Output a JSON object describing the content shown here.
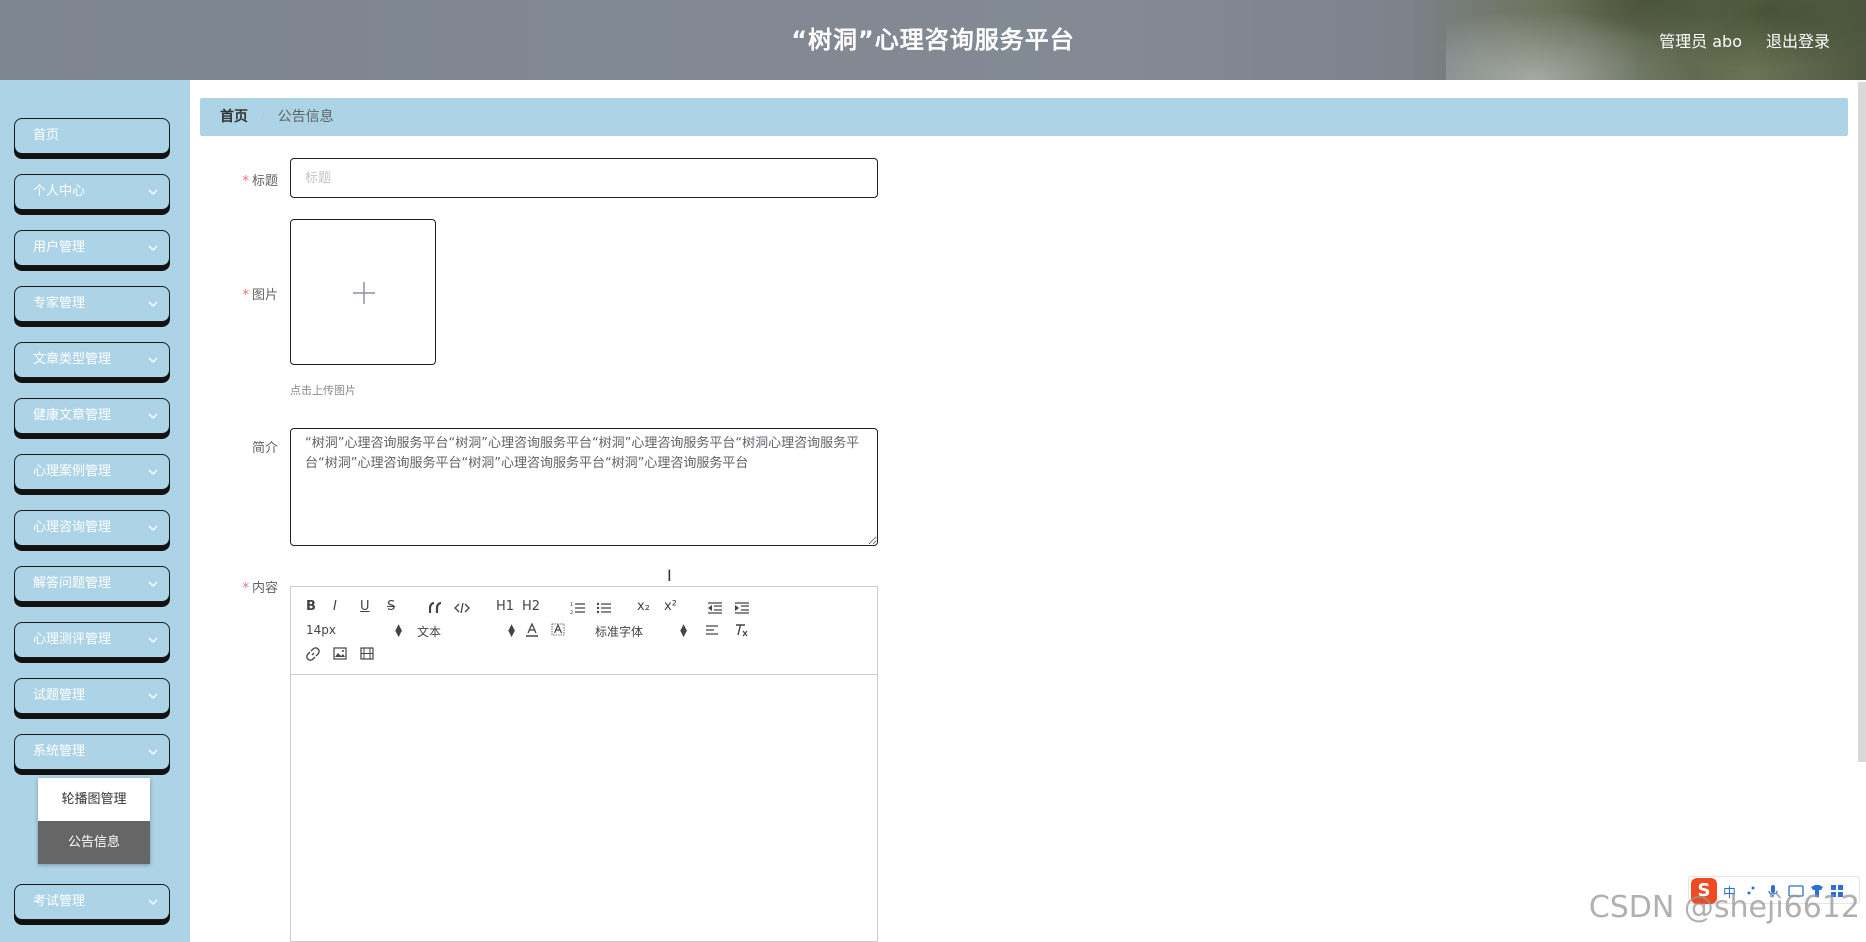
{
  "header": {
    "title": "“树洞”心理咨询服务平台",
    "user": "管理员 abo",
    "logout": "退出登录"
  },
  "sidebar": {
    "items": [
      {
        "label": "首页",
        "has_chevron": false
      },
      {
        "label": "个人中心",
        "has_chevron": true
      },
      {
        "label": "用户管理",
        "has_chevron": true
      },
      {
        "label": "专家管理",
        "has_chevron": true
      },
      {
        "label": "文章类型管理",
        "has_chevron": true
      },
      {
        "label": "健康文章管理",
        "has_chevron": true
      },
      {
        "label": "心理案例管理",
        "has_chevron": true
      },
      {
        "label": "心理咨询管理",
        "has_chevron": true
      },
      {
        "label": "解答问题管理",
        "has_chevron": true
      },
      {
        "label": "心理测评管理",
        "has_chevron": true
      },
      {
        "label": "试题管理",
        "has_chevron": true
      },
      {
        "label": "系统管理",
        "has_chevron": true
      },
      {
        "label": "考试管理",
        "has_chevron": true
      }
    ],
    "submenu": [
      {
        "label": "轮播图管理",
        "active": false
      },
      {
        "label": "公告信息",
        "active": true
      }
    ]
  },
  "breadcrumb": {
    "home": "首页",
    "separator": "/",
    "current": "公告信息"
  },
  "form": {
    "title": {
      "label": "标题",
      "placeholder": "标题",
      "value": ""
    },
    "image": {
      "label": "图片",
      "tip": "点击上传图片"
    },
    "intro": {
      "label": "简介",
      "value": "“树洞”心理咨询服务平台“树洞”心理咨询服务平台“树洞”心理咨询服务平台“树洞心理咨询服务平台“树洞”心理咨询服务平台“树洞”心理咨询服务平台“树洞”心理咨询服务平台"
    },
    "content": {
      "label": "内容"
    }
  },
  "editor": {
    "font_size": "14px",
    "paragraph": "文本",
    "font_family": "标准字体",
    "buttons": [
      "B",
      "I",
      "U",
      "S",
      "“",
      "</>",
      "H1",
      "H2",
      "ol",
      "ul",
      "x₂",
      "x²",
      "outdent",
      "indent",
      "color",
      "background",
      "align",
      "clean",
      "link",
      "image",
      "video"
    ]
  },
  "watermark": "CSDN @shejì6612",
  "ime": {
    "label": "中"
  },
  "colors": {
    "sidebar_bg": "#add4e6",
    "breadcrumb_bg": "#add4e6",
    "required": "#f56c6c",
    "submenu_active": "#666666"
  }
}
